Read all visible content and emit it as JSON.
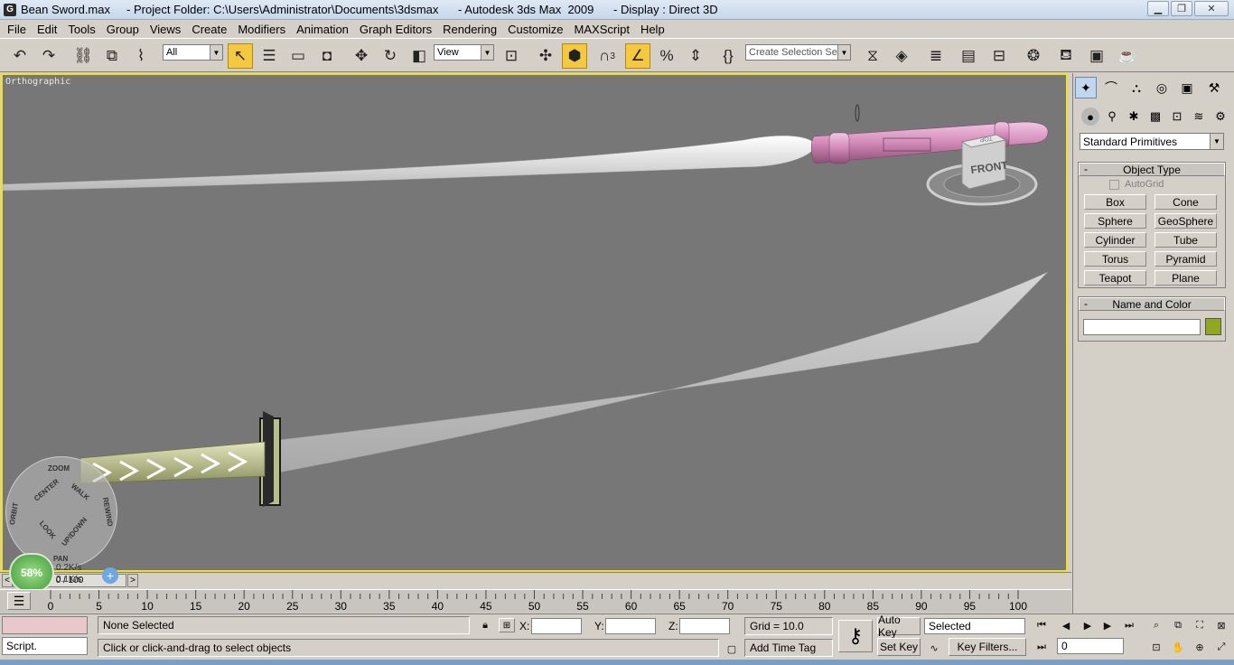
{
  "window": {
    "title": "Bean Sword.max     - Project Folder: C:\\Users\\Administrator\\Documents\\3dsmax      - Autodesk 3ds Max  2009      - Display : Direct 3D",
    "icon_letter": "G"
  },
  "menu": [
    "File",
    "Edit",
    "Tools",
    "Group",
    "Views",
    "Create",
    "Modifiers",
    "Animation",
    "Graph Editors",
    "Rendering",
    "Customize",
    "MAXScript",
    "Help"
  ],
  "toolbar": {
    "filter_value": "All",
    "refcoord_value": "View",
    "selection_set_placeholder": "Create Selection Set",
    "snap_label": "3"
  },
  "viewport": {
    "label": "Orthographic",
    "viewcube_face": "FRONT",
    "viewcube_top": "TOP"
  },
  "nav_wheel": {
    "zoom": "ZOOM",
    "center": "CENTER",
    "walk": "WALK",
    "orbit": "ORBIT",
    "rewind": "REWIND",
    "look": "LOOK",
    "updown": "UP/DOWN",
    "pan": "PAN"
  },
  "command_panel": {
    "category": "Standard Primitives",
    "object_type_title": "Object Type",
    "autogrid_label": "AutoGrid",
    "primitives": [
      "Box",
      "Cone",
      "Sphere",
      "GeoSphere",
      "Cylinder",
      "Tube",
      "Torus",
      "Pyramid",
      "Teapot",
      "Plane"
    ],
    "name_color_title": "Name and Color",
    "name_value": "",
    "swatch_color": "#8fa820"
  },
  "timeline": {
    "frame_display": "0 / 100",
    "network_percent": "58%",
    "upload_rate": "0.2K/s",
    "download_rate": "0.1K/s",
    "ticks": [
      "0",
      "5",
      "10",
      "15",
      "20",
      "25",
      "30",
      "35",
      "40",
      "45",
      "50",
      "55",
      "60",
      "65",
      "70",
      "75",
      "80",
      "85",
      "90",
      "95",
      "100"
    ]
  },
  "status": {
    "script_label": "Script.",
    "selection_status": "None Selected",
    "prompt": "Click or click-and-drag to select objects",
    "x_label": "X:",
    "y_label": "Y:",
    "z_label": "Z:",
    "x_value": "",
    "y_value": "",
    "z_value": "",
    "grid": "Grid = 10.0",
    "add_time_tag": "Add Time Tag",
    "auto_key": "Auto Key",
    "set_key": "Set Key",
    "key_mode_select": "Selected",
    "key_filters": "Key Filters...",
    "current_frame": "0"
  },
  "colors": {
    "viewport_bg": "#777777",
    "active_border": "#f0e020",
    "highlight": "#f5c842",
    "pink_handle": "#d99ac4",
    "green_handle": "#b9bf8a"
  }
}
